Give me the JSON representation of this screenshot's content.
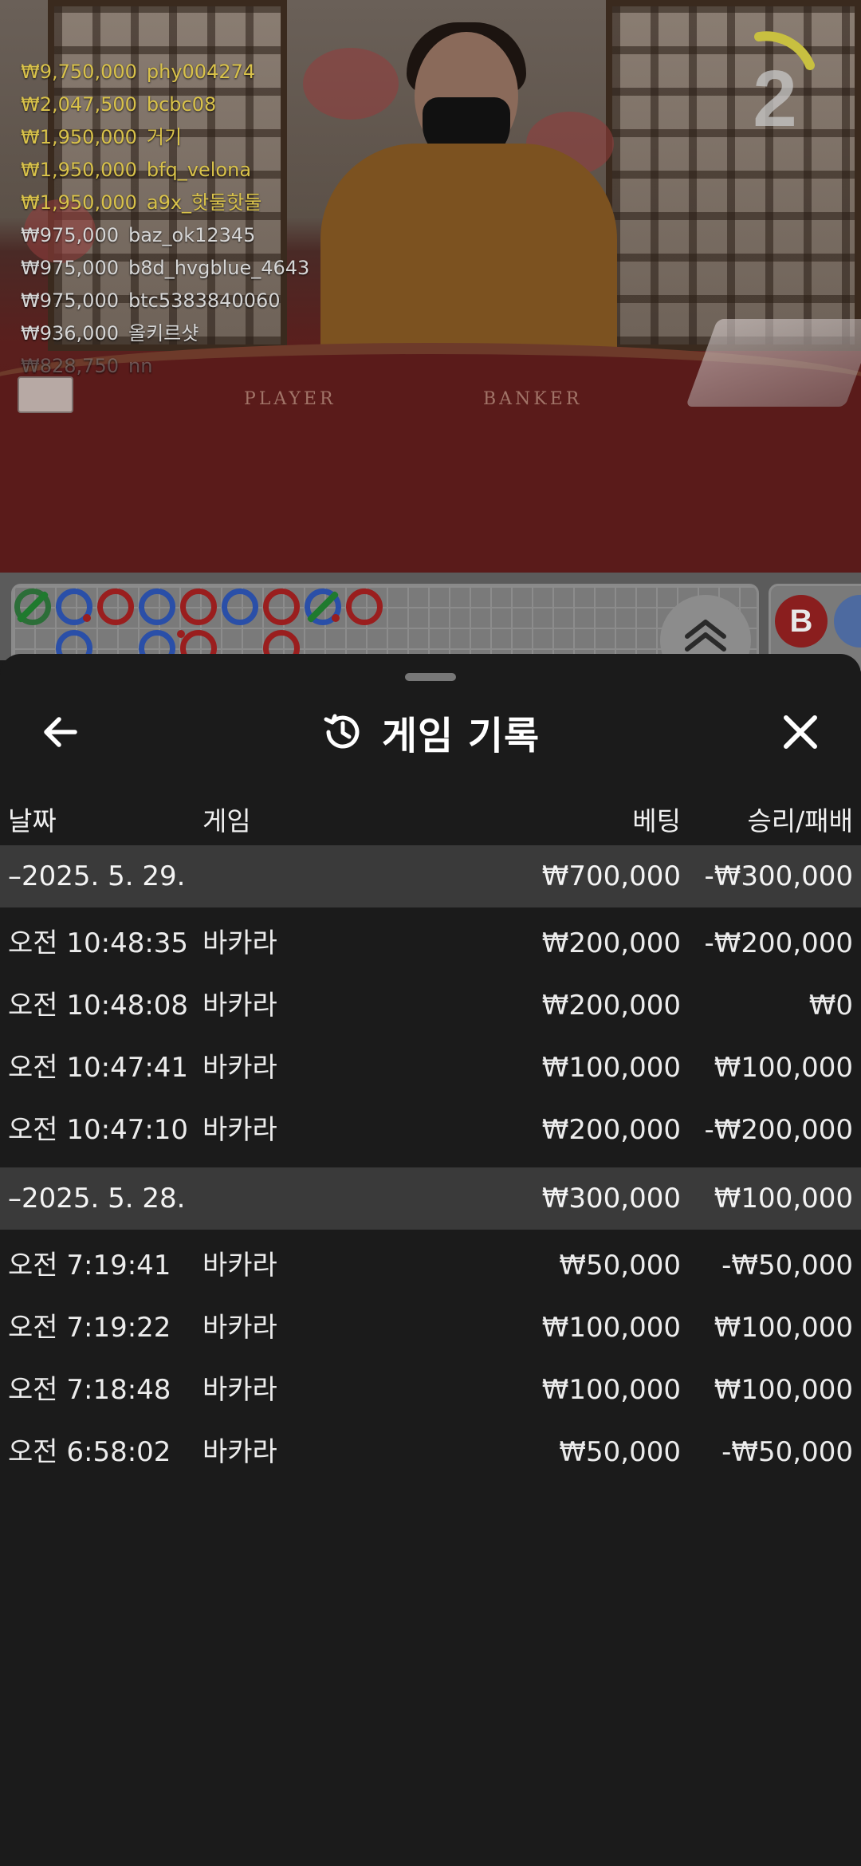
{
  "video": {
    "countdown": "2",
    "bet_feed": [
      {
        "amount": "₩9,750,000",
        "user": "phy004274",
        "tone": "gold"
      },
      {
        "amount": "₩2,047,500",
        "user": "bcbc08",
        "tone": "gold"
      },
      {
        "amount": "₩1,950,000",
        "user": "거기",
        "tone": "gold"
      },
      {
        "amount": "₩1,950,000",
        "user": "bfq_velona",
        "tone": "gold"
      },
      {
        "amount": "₩1,950,000",
        "user": "a9x_핫둘핫둘",
        "tone": "gold"
      },
      {
        "amount": "₩975,000",
        "user": "baz_ok12345",
        "tone": "silver"
      },
      {
        "amount": "₩975,000",
        "user": "b8d_hvgblue_4643",
        "tone": "silver"
      },
      {
        "amount": "₩975,000",
        "user": "btc5383840060",
        "tone": "silver"
      },
      {
        "amount": "₩936,000",
        "user": "올키르샷",
        "tone": "silver"
      },
      {
        "amount": "₩828,750",
        "user": "nn",
        "tone": "fade"
      }
    ],
    "table_labels": {
      "player": "PLAYER",
      "banker": "BANKER"
    }
  },
  "roadmap": {
    "badge_label": "B"
  },
  "sheet": {
    "title": "게임 기록",
    "columns": {
      "date": "날짜",
      "game": "게임",
      "bet": "베팅",
      "result": "승리/패배"
    },
    "groups": [
      {
        "date": "–2025. 5. 29.",
        "bet": "₩700,000",
        "result": "-₩300,000",
        "rows": [
          {
            "time": "오전 10:48:35",
            "game": "바카라",
            "bet": "₩200,000",
            "result": "-₩200,000"
          },
          {
            "time": "오전 10:48:08",
            "game": "바카라",
            "bet": "₩200,000",
            "result": "₩0"
          },
          {
            "time": "오전 10:47:41",
            "game": "바카라",
            "bet": "₩100,000",
            "result": "₩100,000"
          },
          {
            "time": "오전 10:47:10",
            "game": "바카라",
            "bet": "₩200,000",
            "result": "-₩200,000"
          }
        ]
      },
      {
        "date": "–2025. 5. 28.",
        "bet": "₩300,000",
        "result": "₩100,000",
        "rows": [
          {
            "time": "오전 7:19:41",
            "game": "바카라",
            "bet": "₩50,000",
            "result": "-₩50,000"
          },
          {
            "time": "오전 7:19:22",
            "game": "바카라",
            "bet": "₩100,000",
            "result": "₩100,000"
          },
          {
            "time": "오전 7:18:48",
            "game": "바카라",
            "bet": "₩100,000",
            "result": "₩100,000"
          },
          {
            "time": "오전 6:58:02",
            "game": "바카라",
            "bet": "₩50,000",
            "result": "-₩50,000"
          }
        ]
      }
    ]
  },
  "colors": {
    "sheet_bg": "#1b1b1b",
    "group_row_bg": "#3a3a3a",
    "feed_gold": "#d9c24a",
    "timer_arc": "#c8c040"
  }
}
